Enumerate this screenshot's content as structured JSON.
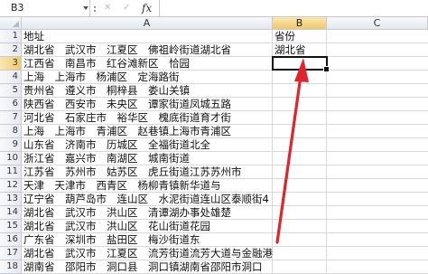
{
  "formula_bar": {
    "name_box": "B3",
    "formula_value": "",
    "fx_label": "fx"
  },
  "columns": [
    "A",
    "B",
    "C"
  ],
  "selected_column": "B",
  "selected_row": "3",
  "rows": [
    {
      "num": "1",
      "a": "地址",
      "b": "省份"
    },
    {
      "num": "2",
      "a": "湖北省　武汉市　江夏区　佛祖岭街道湖北省",
      "b": "湖北省"
    },
    {
      "num": "3",
      "a": "江西省　南昌市　红谷滩新区　恰园",
      "b": ""
    },
    {
      "num": "4",
      "a": "上海　上海市　杨浦区　定海路街",
      "b": ""
    },
    {
      "num": "5",
      "a": "贵州省　遵义市　桐梓县　娄山关镇",
      "b": ""
    },
    {
      "num": "6",
      "a": "陕西省　西安市　未央区　谭家街道凤城五路",
      "b": ""
    },
    {
      "num": "7",
      "a": "河北省　石家庄市　裕华区　槐底街道育才街",
      "b": ""
    },
    {
      "num": "8",
      "a": "上海　上海市　青浦区　赵巷镇上海市青浦区",
      "b": ""
    },
    {
      "num": "9",
      "a": "山东省　济南市　历城区　全福街道北全",
      "b": ""
    },
    {
      "num": "10",
      "a": "浙江省　嘉兴市　南湖区　城南街道",
      "b": ""
    },
    {
      "num": "11",
      "a": "江苏省　苏州市　姑苏区　虎丘街道江苏苏州市",
      "b": ""
    },
    {
      "num": "12",
      "a": "天津　天津市　西青区　杨柳青镇新华道与",
      "b": ""
    },
    {
      "num": "13",
      "a": "辽宁省　葫芦岛市　连山区　水泥街道连山区泰顺街4",
      "b": ""
    },
    {
      "num": "14",
      "a": "湖北省　武汉市　洪山区　清谭湖办事处雄楚",
      "b": ""
    },
    {
      "num": "15",
      "a": "湖北省　武汉市　洪山区　花山街道花园",
      "b": ""
    },
    {
      "num": "16",
      "a": "广东省　深圳市　盐田区　梅沙街道东",
      "b": ""
    },
    {
      "num": "17",
      "a": "湖北省　武汉市　江夏区　流芳街道流芳大道与金融港",
      "b": ""
    },
    {
      "num": "18",
      "a": "湖南省　邵阳市　洞口县　洞口镇湖南省邵阳市洞口",
      "b": ""
    }
  ],
  "annotation": {
    "type": "red-arrow",
    "color": "#e0242b"
  }
}
